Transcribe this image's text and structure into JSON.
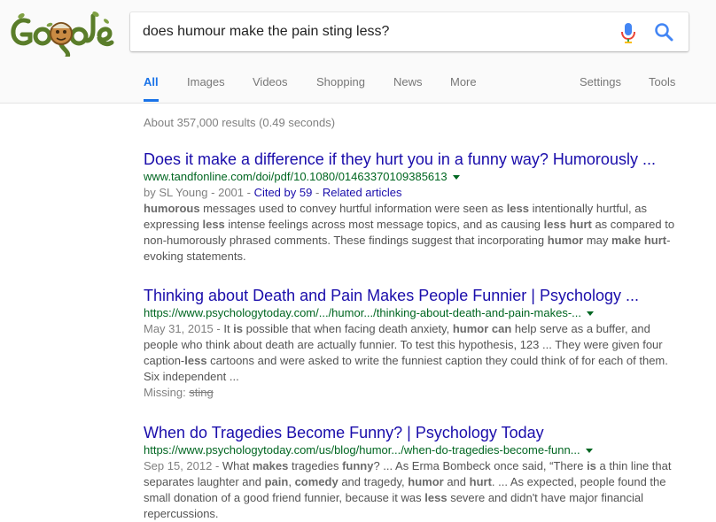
{
  "logo": {
    "alt_text": "Google"
  },
  "search": {
    "query": "does humour make the pain sting less?"
  },
  "icons": {
    "mic": "microphone-icon",
    "search": "search-icon"
  },
  "colors": {
    "link": "#1a0dab",
    "url": "#006621",
    "accent": "#1a73e8",
    "snippet": "#545454"
  },
  "tabs": [
    {
      "label": "All",
      "active": true
    },
    {
      "label": "Images"
    },
    {
      "label": "Videos"
    },
    {
      "label": "Shopping"
    },
    {
      "label": "News"
    },
    {
      "label": "More"
    },
    {
      "label": "Settings"
    },
    {
      "label": "Tools"
    }
  ],
  "stats": "About 357,000 results (0.49 seconds)",
  "results": [
    {
      "title": "Does it make a difference if they hurt you in a funny way? Humorously ...",
      "url": "www.tandfonline.com/doi/pdf/10.1080/01463370109385613",
      "meta_prefix": "by SL Young - 2001 - ",
      "cited_by": "Cited by 59",
      "meta_sep": " - ",
      "related": "Related articles",
      "snippet": [
        {
          "t": "humorous",
          "b": true
        },
        {
          "t": " messages used to convey hurtful information were seen as "
        },
        {
          "t": "less",
          "b": true
        },
        {
          "t": " intentionally hurtful, as expressing "
        },
        {
          "t": "less",
          "b": true
        },
        {
          "t": " intense feelings across most message topics, and as causing "
        },
        {
          "t": "less hurt",
          "b": true
        },
        {
          "t": " as compared to non-humorously phrased comments. These findings suggest that incorporating "
        },
        {
          "t": "humor",
          "b": true
        },
        {
          "t": " may "
        },
        {
          "t": "make hurt",
          "b": true
        },
        {
          "t": "-evoking statements."
        }
      ]
    },
    {
      "title": "Thinking about Death and Pain Makes People Funnier | Psychology ...",
      "url": "https://www.psychologytoday.com/.../humor.../thinking-about-death-and-pain-makes-...",
      "date": "May 31, 2015 - ",
      "snippet": [
        {
          "t": "It ",
          "b": false
        },
        {
          "t": "is",
          "b": true
        },
        {
          "t": " possible that when facing death anxiety, "
        },
        {
          "t": "humor can",
          "b": true
        },
        {
          "t": " help serve as a buffer, and people who think about death are actually funnier. To test this hypothesis, 123 ... They were given four caption-"
        },
        {
          "t": "less",
          "b": true
        },
        {
          "t": " cartoons and were asked to write the funniest caption they could think of for each of them. Six independent ..."
        }
      ],
      "missing_label": "Missing: ",
      "missing_term": "sting"
    },
    {
      "title": "When do Tragedies Become Funny? | Psychology Today",
      "url": "https://www.psychologytoday.com/us/blog/humor.../when-do-tragedies-become-funn...",
      "date": "Sep 15, 2012 - ",
      "snippet": [
        {
          "t": "What "
        },
        {
          "t": "makes",
          "b": true
        },
        {
          "t": " tragedies "
        },
        {
          "t": "funny",
          "b": true
        },
        {
          "t": "? ... As Erma Bombeck once said, “There "
        },
        {
          "t": "is",
          "b": true
        },
        {
          "t": " a thin line that separates laughter and "
        },
        {
          "t": "pain",
          "b": true
        },
        {
          "t": ", "
        },
        {
          "t": "comedy",
          "b": true
        },
        {
          "t": " and tragedy, "
        },
        {
          "t": "humor",
          "b": true
        },
        {
          "t": " and "
        },
        {
          "t": "hurt",
          "b": true
        },
        {
          "t": ". ... As expected, people found the small donation of a good friend funnier, because it was "
        },
        {
          "t": "less",
          "b": true
        },
        {
          "t": " severe and didn't have major financial repercussions."
        }
      ]
    }
  ]
}
